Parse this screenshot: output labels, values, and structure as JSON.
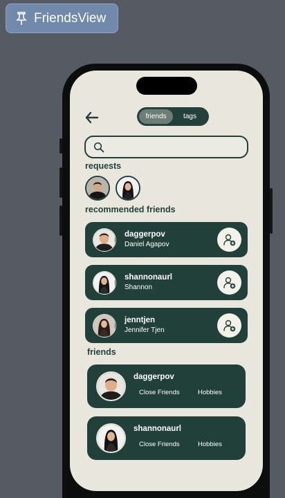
{
  "preview": {
    "label": "FriendsView",
    "icon": "pin-icon"
  },
  "header": {
    "back_icon": "arrow-left-icon",
    "tabs": [
      {
        "label": "friends",
        "active": true
      },
      {
        "label": "tags",
        "active": false
      }
    ]
  },
  "search": {
    "placeholder": "",
    "value": "",
    "icon": "search-icon"
  },
  "requests": {
    "title": "requests",
    "avatars": [
      "person-photo-avatar",
      "person-photo-avatar"
    ]
  },
  "recommended": {
    "title": "recommended friends",
    "items": [
      {
        "username": "daggerpov",
        "name": "Daniel Agapov",
        "action_icon": "add-friend-icon"
      },
      {
        "username": "shannonaurl",
        "name": "Shannon",
        "action_icon": "add-friend-icon"
      },
      {
        "username": "jenntjen",
        "name": "Jennifer Tjen",
        "action_icon": "add-friend-icon"
      }
    ]
  },
  "friends": {
    "title": "friends",
    "items": [
      {
        "username": "daggerpov",
        "tags": [
          "Close Friends",
          "Hobbies"
        ]
      },
      {
        "username": "shannonaurl",
        "tags": [
          "Close Friends",
          "Hobbies"
        ]
      }
    ]
  },
  "colors": {
    "background": "#565b63",
    "screen": "#e9e7dd",
    "primary": "#22403a",
    "preview_tag": "#7189ab"
  }
}
